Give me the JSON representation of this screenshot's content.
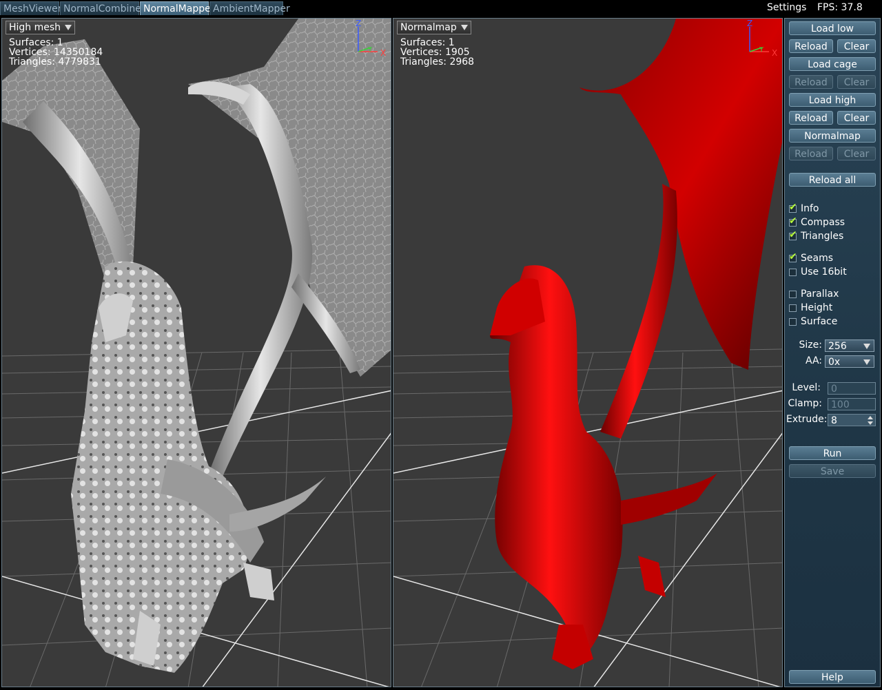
{
  "tabs": [
    {
      "label": "MeshViewer",
      "active": false
    },
    {
      "label": "NormalCombiner",
      "active": false
    },
    {
      "label": "NormalMapper",
      "active": true
    },
    {
      "label": "AmbientMapper",
      "active": false
    }
  ],
  "header": {
    "settings_label": "Settings",
    "fps_label": "FPS: 37.8"
  },
  "left_viewport": {
    "mode": "High mesh",
    "surfaces": "Surfaces: 1",
    "vertices": "Vertices: 14350184",
    "triangles": "Triangles: 4779831",
    "compass": {
      "z": "Z",
      "y": "Y",
      "x": "X"
    }
  },
  "right_viewport": {
    "mode": "Normalmap",
    "surfaces": "Surfaces: 1",
    "vertices": "Vertices: 1905",
    "triangles": "Triangles: 2968",
    "compass": {
      "z": "Z",
      "y": "Y",
      "x": "X"
    }
  },
  "panel": {
    "load_low": "Load low",
    "reload_low": "Reload",
    "clear_low": "Clear",
    "load_cage": "Load cage",
    "reload_cage": "Reload",
    "clear_cage": "Clear",
    "load_high": "Load high",
    "reload_high": "Reload",
    "clear_high": "Clear",
    "normalmap": "Normalmap",
    "reload_normalmap": "Reload",
    "clear_normalmap": "Clear",
    "reload_all": "Reload all",
    "checkboxes": {
      "info": {
        "label": "Info",
        "checked": true
      },
      "compass": {
        "label": "Compass",
        "checked": true
      },
      "triangles": {
        "label": "Triangles",
        "checked": true
      },
      "seams": {
        "label": "Seams",
        "checked": true
      },
      "use16bit": {
        "label": "Use 16bit",
        "checked": false
      },
      "parallax": {
        "label": "Parallax",
        "checked": false
      },
      "height": {
        "label": "Height",
        "checked": false
      },
      "surface": {
        "label": "Surface",
        "checked": false
      }
    },
    "size_label": "Size:",
    "size_value": "256",
    "aa_label": "AA:",
    "aa_value": "0x",
    "level_label": "Level:",
    "level_value": "0",
    "clamp_label": "Clamp:",
    "clamp_value": "100",
    "extrude_label": "Extrude:",
    "extrude_value": "8",
    "run": "Run",
    "save": "Save",
    "help": "Help"
  },
  "colors": {
    "accent": "#5a7d93",
    "check": "#b8ff3a",
    "viewport_bg": "#3a3a3a",
    "lowpoly_model": "#c00000",
    "highpoly_model": "#bdbdbd"
  }
}
